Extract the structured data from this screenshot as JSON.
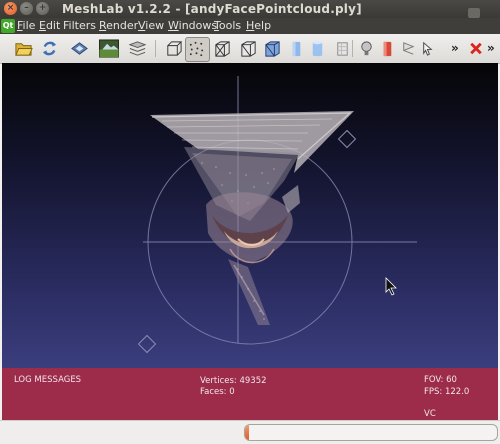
{
  "window": {
    "title": "MeshLab v1.2.2 - [andyFacePointcloud.ply]"
  },
  "menu": {
    "items": [
      {
        "label_u": "F",
        "label_rest": "ile"
      },
      {
        "label_u": "E",
        "label_rest": "dit"
      },
      {
        "label_u": "",
        "label_rest": "Filters"
      },
      {
        "label_u": "R",
        "label_rest": "ender"
      },
      {
        "label_u": "V",
        "label_rest": "iew"
      },
      {
        "label_u": "W",
        "label_rest": "indows"
      },
      {
        "label_u": "T",
        "label_rest": "ools"
      },
      {
        "label_u": "H",
        "label_rest": "elp"
      }
    ]
  },
  "toolbar": {
    "more_left": "»",
    "more_right": "»",
    "icons": [
      "open-folder-icon",
      "reload-icon",
      "save-icon",
      "snapshot-icon",
      "layers-icon",
      "bbox-icon",
      "points-icon",
      "wireframe-icon",
      "hidden-lines-icon",
      "flat-lines-icon",
      "flat-icon",
      "smooth-icon",
      "texture-icon",
      "lighting-icon",
      "fancy-lighting-icon",
      "backface-icon",
      "selection-icon",
      "close-red-x-icon"
    ]
  },
  "info": {
    "log_label": "LOG MESSAGES",
    "vertices_label": "Vertices:",
    "vertices_value": "49352",
    "faces_label": "Faces:",
    "faces_value": "0",
    "fov_label": "FOV:",
    "fov_value": "60",
    "fps_label": "FPS:",
    "fps_value": "122.0",
    "mode": "VC"
  },
  "status": {
    "progress_fraction": 0.015
  },
  "colors": {
    "info_panel": "#9d2c4b",
    "progress_accent": "#e05a21"
  }
}
